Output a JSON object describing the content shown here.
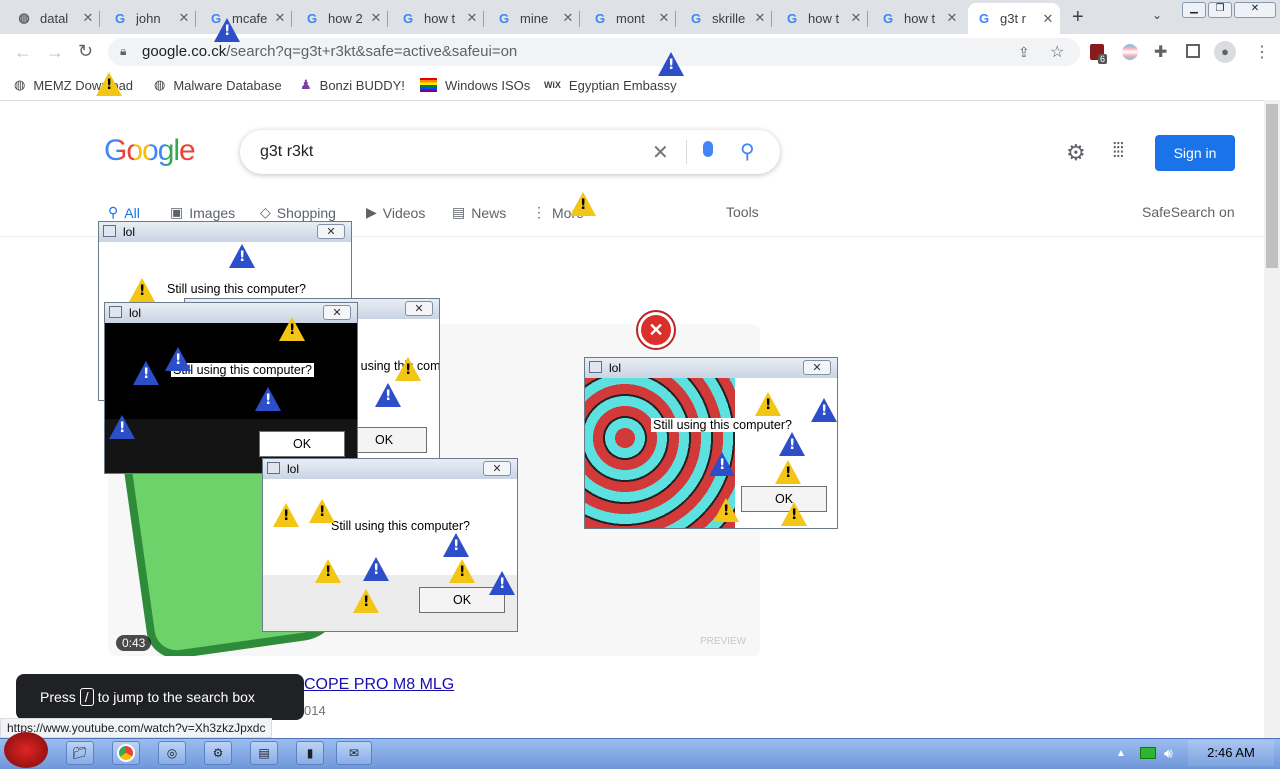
{
  "browser": {
    "tabs": [
      {
        "label": "datal",
        "icon": "globe-icon"
      },
      {
        "label": "john",
        "icon": "google-icon"
      },
      {
        "label": "mcafe",
        "icon": "google-icon"
      },
      {
        "label": "how 2",
        "icon": "google-icon"
      },
      {
        "label": "how t",
        "icon": "google-icon"
      },
      {
        "label": "mine",
        "icon": "google-icon"
      },
      {
        "label": "mont",
        "icon": "google-icon"
      },
      {
        "label": "skrille",
        "icon": "google-icon"
      },
      {
        "label": "how t",
        "icon": "google-icon"
      },
      {
        "label": "how t",
        "icon": "google-icon"
      },
      {
        "label": "g3t r",
        "icon": "google-icon",
        "active": true
      }
    ],
    "url_domain": "google.co.ck",
    "url_path": "/search?q=g3t+r3kt&safe=active&safeui=on",
    "extension_badge": "6",
    "bookmarks": [
      {
        "label": "MEMZ Download",
        "icon": "globe-icon"
      },
      {
        "label": "Malware Database",
        "icon": "globe-icon"
      },
      {
        "label": "Bonzi BUDDY!",
        "icon": "bonzi-icon"
      },
      {
        "label": "Windows ISOs",
        "icon": "rainbow-flag-icon"
      },
      {
        "label": "Egyptian Embassy",
        "icon": "wix-icon"
      }
    ]
  },
  "google": {
    "logo": "Google",
    "query": "g3t r3kt",
    "sign_in": "Sign in",
    "nav": [
      "All",
      "Images",
      "Shopping",
      "Videos",
      "News",
      "More",
      "Tools"
    ],
    "safesearch": "SafeSearch on",
    "video_duration": "0:43",
    "result_title_fragment": "COPE PRO M8 MLG",
    "result_date_fragment": "014",
    "preview_label": "PREVIEW",
    "jump_hint_pre": "Press",
    "jump_hint_key": "/",
    "jump_hint_post": "to jump to the search box",
    "status_url": "https://www.youtube.com/watch?v=Xh3zkzJpxdc"
  },
  "dialogs": [
    {
      "title": "lol",
      "message": "Still using this computer?",
      "ok": "OK"
    },
    {
      "title": "lol",
      "message": "Still using this computer?",
      "ok": "OK"
    },
    {
      "title": "lol",
      "message": "Still using this computer?",
      "ok": "OK"
    },
    {
      "title": "lol",
      "message": "Still using this computer?",
      "ok": "OK"
    },
    {
      "title": "lol",
      "message": "Still using this computer?",
      "ok": "OK"
    }
  ],
  "taskbar": {
    "clock": "2:46 AM"
  },
  "colors": {
    "google_blue": "#1a73e8",
    "tabstrip": "#dee1e6",
    "warning_yellow": "#f3c515",
    "info_blue": "#2c4ec9",
    "taskbar_blue": "#6f97d8"
  }
}
